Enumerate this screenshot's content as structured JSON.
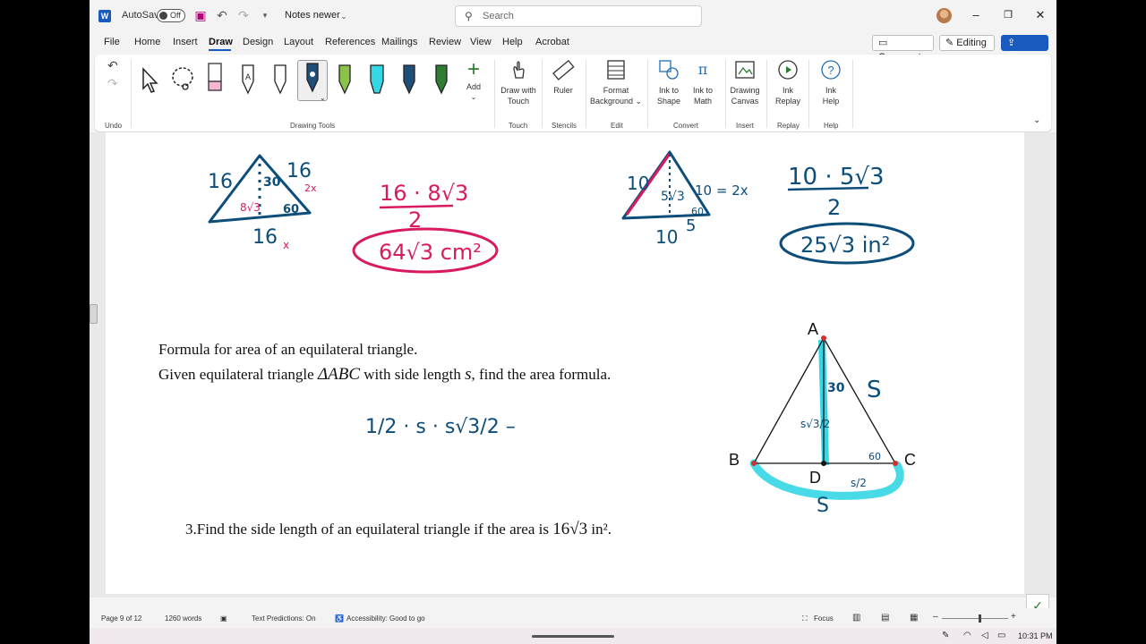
{
  "titlebar": {
    "autosave_label": "AutoSave",
    "autosave_state": "Off",
    "doc_title": "Notes newer",
    "search_placeholder": "Search"
  },
  "menu": {
    "tabs": [
      "File",
      "Home",
      "Insert",
      "Draw",
      "Design",
      "Layout",
      "References",
      "Mailings",
      "Review",
      "View",
      "Help",
      "Acrobat"
    ],
    "active_tab": "Draw",
    "comments": "Comments",
    "editing": "Editing",
    "share": "Share"
  },
  "ribbon": {
    "groups": {
      "undo": "Undo",
      "drawing_tools": "Drawing Tools",
      "touch": "Touch",
      "stencils": "Stencils",
      "edit": "Edit",
      "convert": "Convert",
      "insert": "Insert",
      "replay": "Replay",
      "help": "Help"
    },
    "add_label": "Add",
    "draw_with_touch": [
      "Draw with",
      "Touch"
    ],
    "ruler": "Ruler",
    "format_background": [
      "Format",
      "Background"
    ],
    "ink_to_shape": [
      "Ink to",
      "Shape"
    ],
    "ink_to_math": [
      "Ink to",
      "Math"
    ],
    "drawing_canvas": [
      "Drawing",
      "Canvas"
    ],
    "ink_replay": [
      "Ink",
      "Replay"
    ],
    "ink_help": [
      "Ink",
      "Help"
    ],
    "pen_colors": [
      "#f4b6d2",
      "#ffffff",
      "#1f4e79",
      "#8bc34a",
      "#35d6e6",
      "#1f4e79",
      "#2e7d32"
    ]
  },
  "document": {
    "formula_heading": "Formula for area of an equilateral triangle.",
    "given_prefix": "Given equilateral triangle",
    "given_triangle": "ΔABC",
    "given_mid": "with side length",
    "given_var": "s",
    "given_suffix": ", find the area formula.",
    "problem3_prefix": "3.Find the side length of an equilateral triangle if the area is",
    "problem3_value": "16√3",
    "problem3_unit": "in²."
  },
  "figure_labels": {
    "A": "A",
    "B": "B",
    "C": "C",
    "D": "D"
  },
  "ink": {
    "tri1_side_left": "16",
    "tri1_side_right": "16",
    "tri1_right_x": "2x",
    "tri1_base": "16",
    "tri1_base_x": "x",
    "tri1_angle30": "30",
    "tri1_angle60": "60",
    "tri1_alt": "8√3",
    "calc1_num": "16 · 8√3",
    "calc1_den": "2",
    "calc1_result": "64√3 cm²",
    "tri2_side_left": "10",
    "tri2_alt": "5√3",
    "tri2_right": "10 = 2x",
    "tri2_base": "10",
    "tri2_half": "5",
    "tri2_angle60": "60",
    "calc2_num": "10 · 5√3",
    "calc2_den": "2",
    "calc2_result": "25√3 in²",
    "formula_work": "1/2 · s · s√3/2  –",
    "fig_angle30": "30",
    "fig_side_s": "S",
    "fig_alt": "s√3/2",
    "fig_angle60": "60",
    "fig_half": "s/2",
    "fig_base_s": "S"
  },
  "status": {
    "page": "Page 9 of 12",
    "words": "1260 words",
    "text_predictions": "Text Predictions: On",
    "accessibility": "Accessibility: Good to go",
    "focus": "Focus"
  },
  "taskbar": {
    "time": "10:31 PM"
  },
  "colors": {
    "accent": "#185abd",
    "ink_blue": "#0d4d7a",
    "ink_pink": "#d81b60",
    "highlight_cyan": "#35d6e6"
  }
}
